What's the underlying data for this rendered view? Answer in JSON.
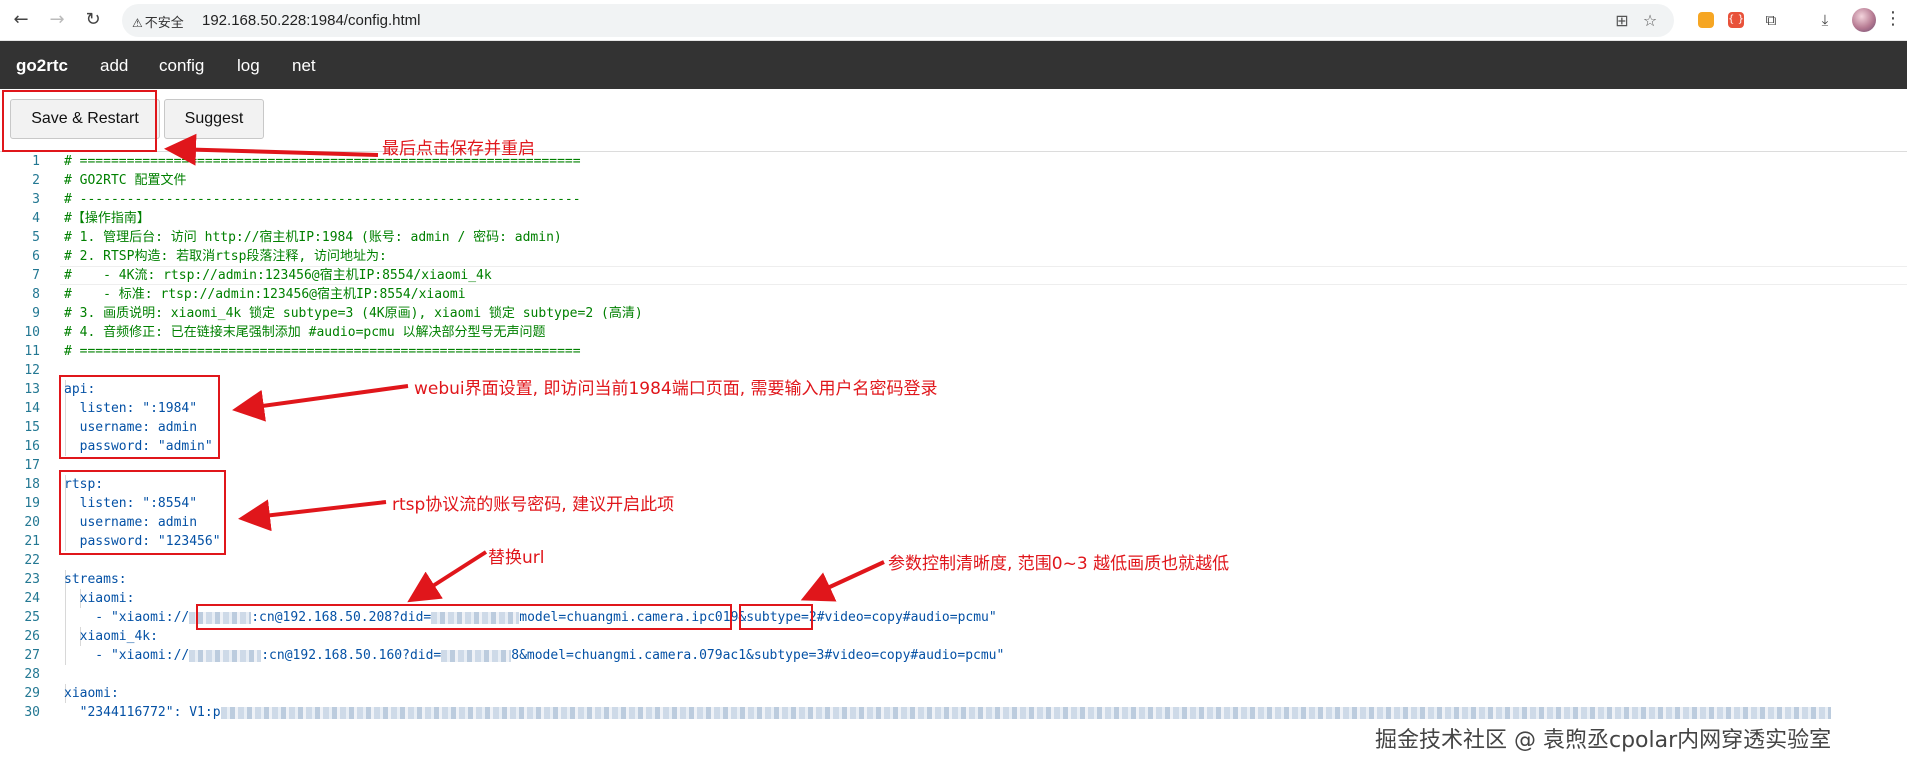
{
  "browser": {
    "back_icon": "←",
    "forward_icon": "→",
    "reload_icon": "↻",
    "security_label": "不安全",
    "url": "192.168.50.228:1984/config.html"
  },
  "navbar": {
    "brand": "go2rtc",
    "items": [
      "add",
      "config",
      "log",
      "net"
    ]
  },
  "toolbar": {
    "save_label": "Save & Restart",
    "suggest_label": "Suggest"
  },
  "editor": {
    "lines": [
      "# ================================================================",
      "# GO2RTC 配置文件",
      "# ----------------------------------------------------------------",
      "#【操作指南】",
      "# 1. 管理后台: 访问 http://宿主机IP:1984 (账号: admin / 密码: admin)",
      "# 2. RTSP构造: 若取消rtsp段落注释, 访问地址为:",
      "#    - 4K流: rtsp://admin:123456@宿主机IP:8554/xiaomi_4k",
      "#    - 标准: rtsp://admin:123456@宿主机IP:8554/xiaomi",
      "# 3. 画质说明: xiaomi_4k 锁定 subtype=3 (4K原画), xiaomi 锁定 subtype=2 (高清)",
      "# 4. 音频修正: 已在链接末尾强制添加 #audio=pcmu 以解决部分型号无声问题",
      "# ================================================================",
      "",
      "api:",
      "  listen: \":1984\"",
      "  username: admin",
      "  password: \"admin\"",
      "",
      "rtsp:",
      "  listen: \":8554\"",
      "  username: admin",
      "  password: \"123456\"",
      "",
      "streams:",
      "  xiaomi:",
      "    - \"xiaomi://",
      "  xiaomi_4k:",
      "    - \"xiaomi://",
      "",
      "xiaomi:",
      "  \"2344116772\": V1:p"
    ],
    "line25_mid": ":cn@192.168.50.208?did=",
    "line25_model": "model=chuangmi.camera.ipc019&",
    "line25_subtype": "subtype=2",
    "line25_tail": "#video=copy#audio=pcmu\"",
    "line27_mid": ":cn@192.168.50.160?did=",
    "line27_tail": "8&model=chuangmi.camera.079ac1&subtype=3#video=copy#audio=pcmu\""
  },
  "annotations": {
    "save_note": "最后点击保存并重启",
    "api_note": "webui界面设置, 即访问当前1984端口页面, 需要输入用户名密码登录",
    "rtsp_note": "rtsp协议流的账号密码, 建议开启此项",
    "url_note": "替换url",
    "subtype_note": "参数控制清晰度, 范围0~3 越低画质也就越低",
    "color": "#e0161b"
  },
  "watermark": "掘金技术社区 @ 袁煦丞cpolar内网穿透实验室"
}
